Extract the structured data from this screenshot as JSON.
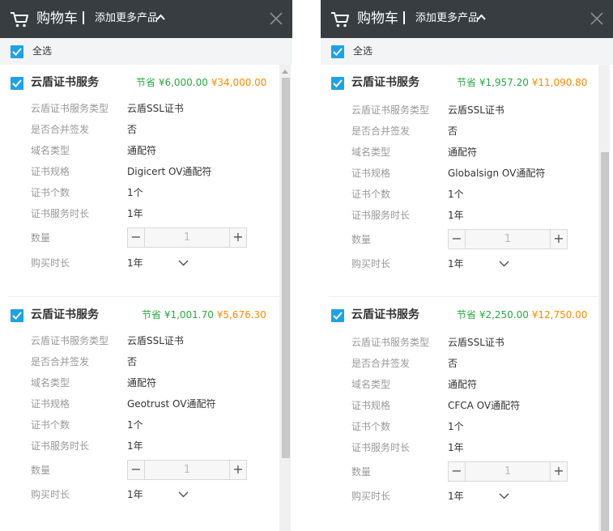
{
  "colors": {
    "header_bg": "#373d41",
    "checkbox": "#1fa1e6",
    "save_green": "#2aa844",
    "price_orange": "#ff8a00"
  },
  "panels": [
    {
      "header": {
        "title": "购物车",
        "add_more": "添加更多产品"
      },
      "select_all": "全选",
      "items": [
        {
          "title": "云盾证书服务",
          "save_label": "节省 ¥6,000.00",
          "price": "¥34,000.00",
          "fields": [
            {
              "label": "云盾证书服务类型",
              "value": "云盾SSL证书"
            },
            {
              "label": "是否合并签发",
              "value": "否"
            },
            {
              "label": "域名类型",
              "value": "通配符"
            },
            {
              "label": "证书规格",
              "value": "Digicert OV通配符"
            },
            {
              "label": "证书个数",
              "value": "1个"
            },
            {
              "label": "证书服务时长",
              "value": "1年"
            }
          ],
          "quantity_label": "数量",
          "quantity": "1",
          "duration_label": "购买时长",
          "duration": "1年"
        },
        {
          "title": "云盾证书服务",
          "save_label": "节省 ¥1,001.70",
          "price": "¥5,676.30",
          "fields": [
            {
              "label": "云盾证书服务类型",
              "value": "云盾SSL证书"
            },
            {
              "label": "是否合并签发",
              "value": "否"
            },
            {
              "label": "域名类型",
              "value": "通配符"
            },
            {
              "label": "证书规格",
              "value": "Geotrust OV通配符"
            },
            {
              "label": "证书个数",
              "value": "1个"
            },
            {
              "label": "证书服务时长",
              "value": "1年"
            }
          ],
          "quantity_label": "数量",
          "quantity": "1",
          "duration_label": "购买时长",
          "duration": "1年"
        }
      ]
    },
    {
      "header": {
        "title": "购物车",
        "add_more": "添加更多产品"
      },
      "select_all": "全选",
      "items": [
        {
          "title": "云盾证书服务",
          "save_label": "节省 ¥1,957.20",
          "price": "¥11,090.80",
          "fields": [
            {
              "label": "云盾证书服务类型",
              "value": "云盾SSL证书"
            },
            {
              "label": "是否合并签发",
              "value": "否"
            },
            {
              "label": "域名类型",
              "value": "通配符"
            },
            {
              "label": "证书规格",
              "value": "Globalsign OV通配符"
            },
            {
              "label": "证书个数",
              "value": "1个"
            },
            {
              "label": "证书服务时长",
              "value": "1年"
            }
          ],
          "quantity_label": "数量",
          "quantity": "1",
          "duration_label": "购买时长",
          "duration": "1年"
        },
        {
          "title": "云盾证书服务",
          "save_label": "节省 ¥2,250.00",
          "price": "¥12,750.00",
          "fields": [
            {
              "label": "云盾证书服务类型",
              "value": "云盾SSL证书"
            },
            {
              "label": "是否合并签发",
              "value": "否"
            },
            {
              "label": "域名类型",
              "value": "通配符"
            },
            {
              "label": "证书规格",
              "value": "CFCA OV通配符"
            },
            {
              "label": "证书个数",
              "value": "1个"
            },
            {
              "label": "证书服务时长",
              "value": "1年"
            }
          ],
          "quantity_label": "数量",
          "quantity": "1",
          "duration_label": "购买时长",
          "duration": "1年"
        }
      ]
    }
  ]
}
